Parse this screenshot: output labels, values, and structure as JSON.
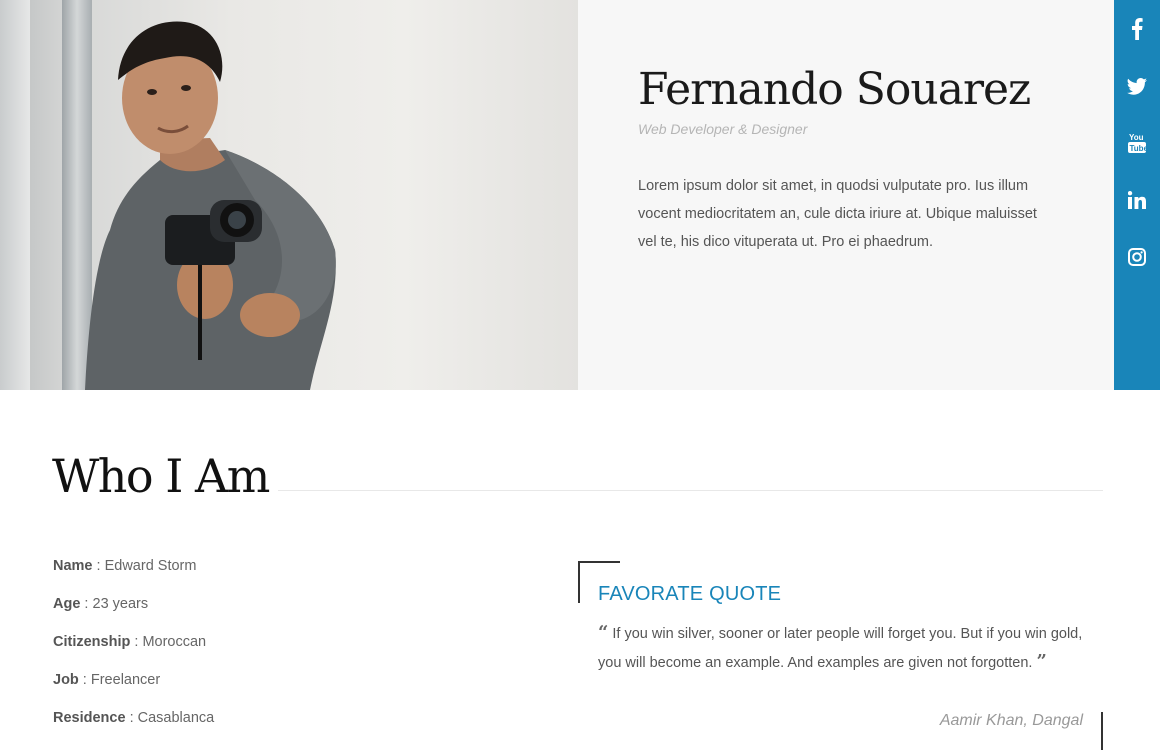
{
  "hero": {
    "photo_alt": "Portrait of a man holding a camera",
    "name": "Fernando Souarez",
    "role": "Web Developer & Designer",
    "bio": "Lorem ipsum dolor sit amet, in quodsi vulputate pro. Ius illum vocent mediocritatem an, cule dicta iriure at. Ubique maluisset vel te, his dico vituperata ut. Pro ei phaedrum."
  },
  "social": {
    "color": "#1985b9",
    "items": [
      {
        "name": "facebook-icon",
        "glyph": "f"
      },
      {
        "name": "twitter-icon",
        "glyph": "twitter"
      },
      {
        "name": "youtube-icon",
        "glyph": "YouTube"
      },
      {
        "name": "linkedin-icon",
        "glyph": "in"
      },
      {
        "name": "instagram-icon",
        "glyph": "instagram"
      }
    ]
  },
  "who": {
    "title": "Who I Am",
    "info": [
      {
        "key": "Name",
        "value": "Edward Storm"
      },
      {
        "key": "Age",
        "value": "23 years"
      },
      {
        "key": "Citizenship",
        "value": "Moroccan"
      },
      {
        "key": "Job",
        "value": "Freelancer"
      },
      {
        "key": "Residence",
        "value": "Casablanca"
      }
    ]
  },
  "quote": {
    "title": "FAVORATE QUOTE",
    "text": "If you win silver, sooner or later people will forget you. But if you win gold, you will become an example. And examples are given not forgotten.",
    "author": "Aamir Khan, Dangal"
  }
}
